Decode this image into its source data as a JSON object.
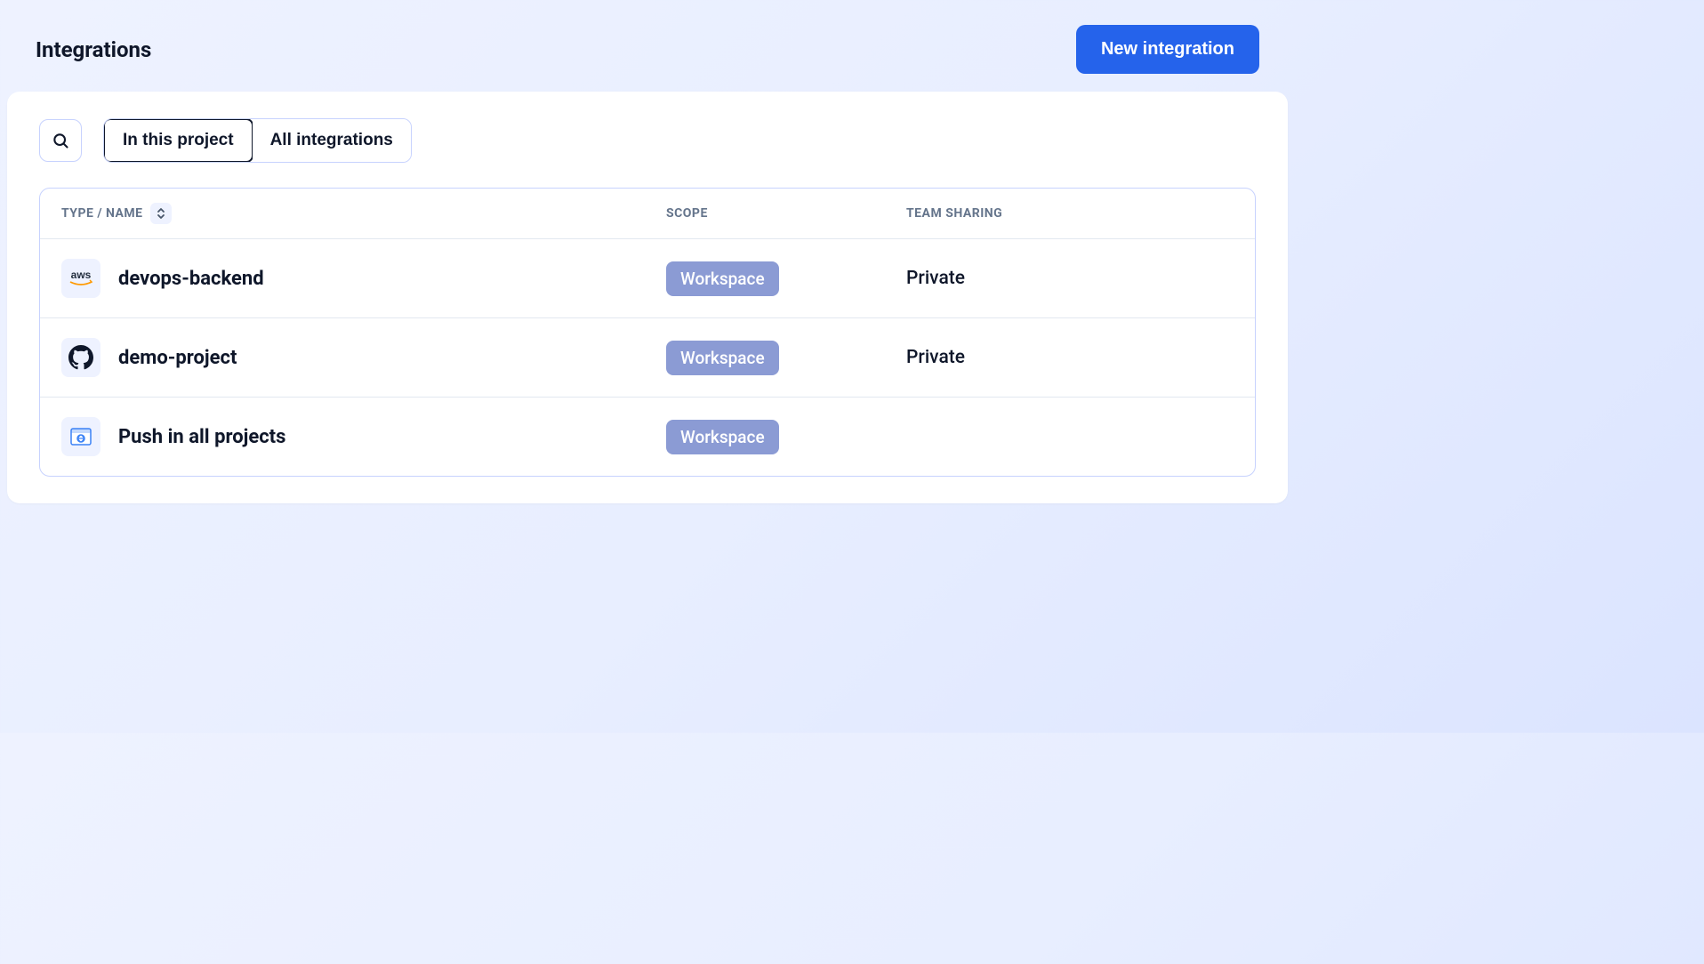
{
  "header": {
    "title": "Integrations",
    "new_button": "New integration"
  },
  "filters": {
    "tabs": [
      {
        "label": "In this project",
        "active": true
      },
      {
        "label": "All integrations",
        "active": false
      }
    ]
  },
  "table": {
    "columns": {
      "name": "TYPE / NAME",
      "scope": "SCOPE",
      "sharing": "TEAM SHARING"
    },
    "rows": [
      {
        "icon": "aws",
        "name": "devops-backend",
        "scope": "Workspace",
        "sharing": "Private"
      },
      {
        "icon": "github",
        "name": "demo-project",
        "scope": "Workspace",
        "sharing": "Private"
      },
      {
        "icon": "webhook",
        "name": "Push in all projects",
        "scope": "Workspace",
        "sharing": ""
      }
    ]
  }
}
